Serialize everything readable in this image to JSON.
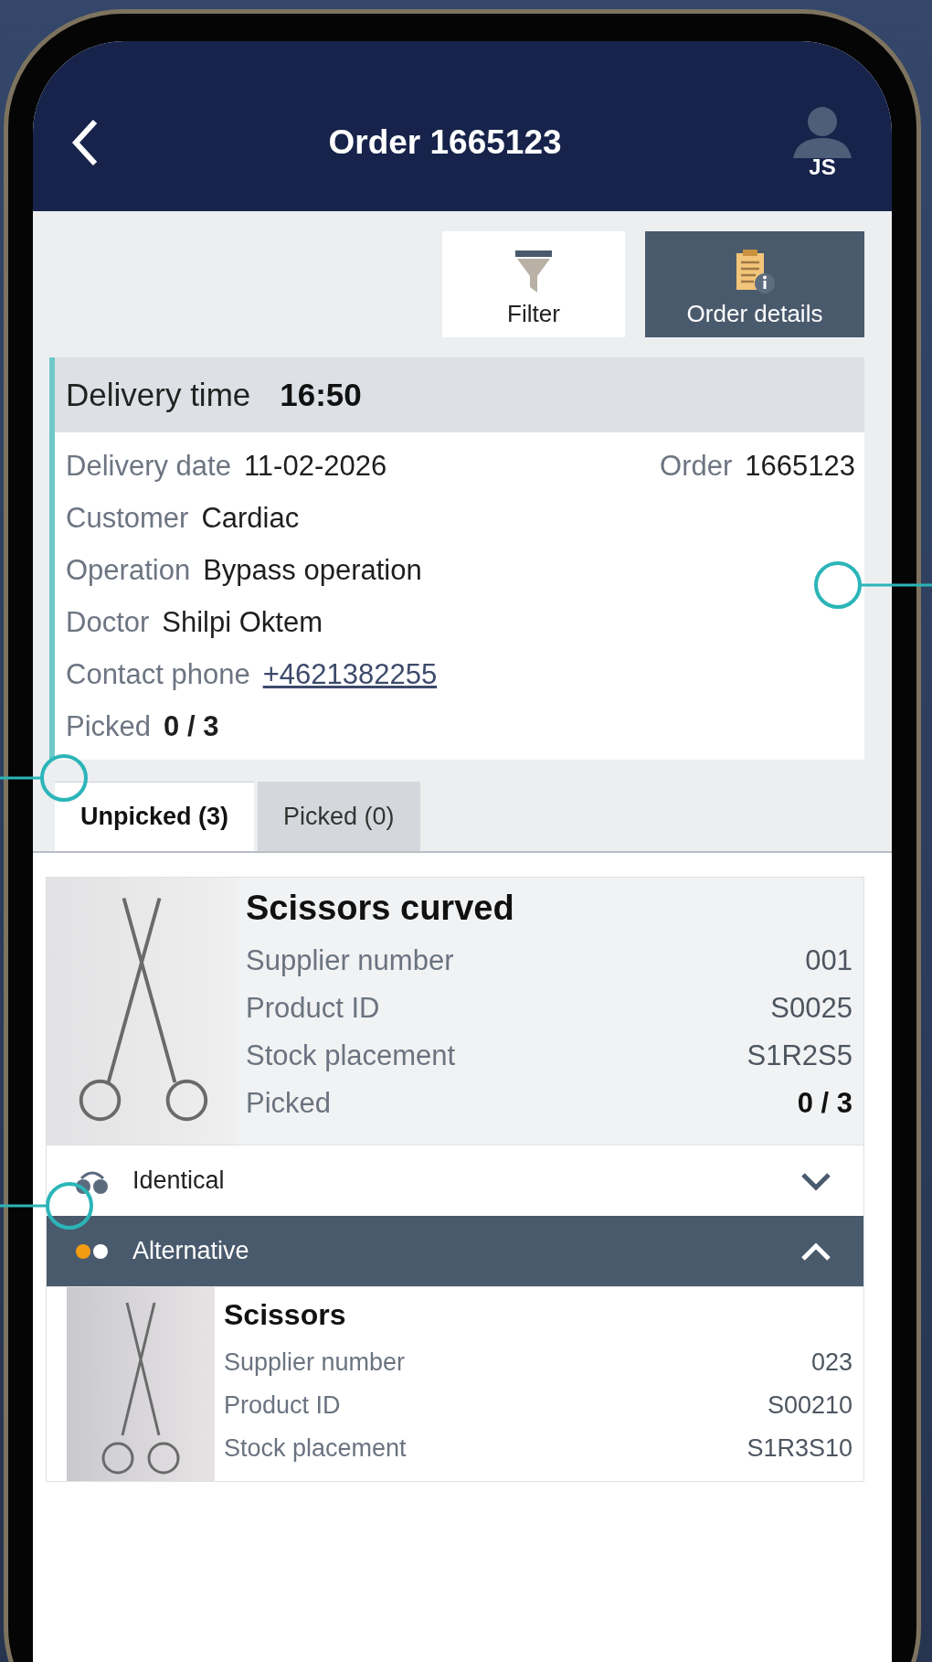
{
  "header": {
    "title": "Order 1665123",
    "user_initials": "JS"
  },
  "toolbar": [
    {
      "label": "Filter",
      "selected": false
    },
    {
      "label": "Order details",
      "selected": true
    }
  ],
  "order_info": {
    "time_label": "Delivery time",
    "time": "16:50",
    "rows": [
      {
        "fields": [
          {
            "label": "Delivery date",
            "value": "11-02-2026",
            "kind": "text"
          },
          {
            "label": "Order",
            "value": "1665123",
            "kind": "text"
          }
        ]
      },
      {
        "fields": [
          {
            "label": "Customer",
            "value": "Cardiac",
            "kind": "text"
          }
        ]
      },
      {
        "fields": [
          {
            "label": "Operation",
            "value": "Bypass operation",
            "kind": "text"
          }
        ]
      },
      {
        "fields": [
          {
            "label": "Doctor",
            "value": "Shilpi Oktem",
            "kind": "text"
          }
        ]
      },
      {
        "fields": [
          {
            "label": "Contact phone",
            "value": "+4621382255",
            "kind": "link"
          }
        ]
      },
      {
        "fields": [
          {
            "label": "Picked",
            "value": "0 / 3",
            "kind": "count"
          }
        ]
      }
    ]
  },
  "tabs": [
    {
      "label": "Unpicked (3)",
      "selected": true
    },
    {
      "label": "Picked (0)",
      "selected": false
    }
  ],
  "product": {
    "name": "Scissors curved",
    "rows": [
      {
        "label": "Supplier number",
        "value": "001",
        "kind": "text"
      },
      {
        "label": "Product ID",
        "value": "S0025",
        "kind": "text"
      },
      {
        "label": "Stock placement",
        "value": "S1R2S5",
        "kind": "text"
      },
      {
        "label": "Picked",
        "value": "0 / 3",
        "kind": "count"
      }
    ]
  },
  "sections": [
    {
      "label": "Identical",
      "expanded": false,
      "kind": "identical"
    },
    {
      "label": "Alternative",
      "expanded": true,
      "kind": "alternative"
    }
  ],
  "alternative_product": {
    "name": "Scissors",
    "rows": [
      {
        "label": "Supplier number",
        "value": "023"
      },
      {
        "label": "Product ID",
        "value": "S00210"
      },
      {
        "label": "Stock placement",
        "value": "S1R3S10"
      }
    ]
  }
}
